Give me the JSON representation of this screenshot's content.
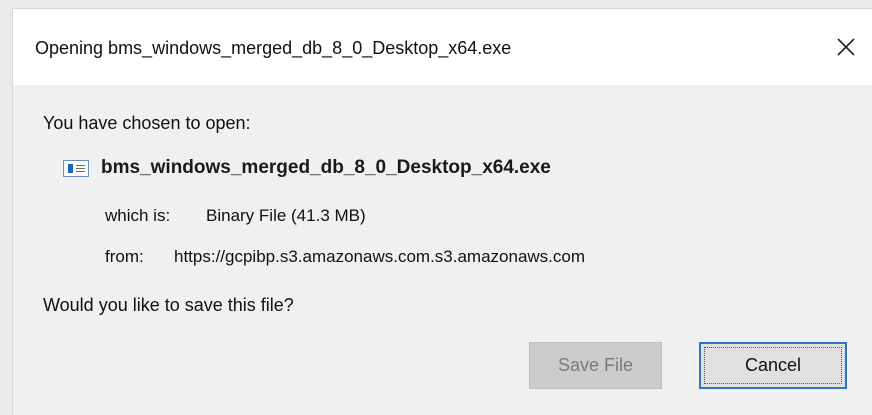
{
  "window": {
    "title": "Opening bms_windows_merged_db_8_0_Desktop_x64.exe",
    "close_icon": "close-icon"
  },
  "content": {
    "intro": "You have chosen to open:",
    "file_icon": "executable-file-icon",
    "filename": "bms_windows_merged_db_8_0_Desktop_x64.exe",
    "which_is_label": "which is:",
    "which_is_value": "Binary File (41.3 MB)",
    "from_label": "from:",
    "from_value": "https://gcpibp.s3.amazonaws.com.s3.amazonaws.com",
    "question": "Would you like to save this file?"
  },
  "buttons": {
    "save_label": "Save File",
    "save_state": "disabled",
    "cancel_label": "Cancel",
    "cancel_state": "focused"
  },
  "colors": {
    "accent": "#2f72c9",
    "background": "#f0f0f0",
    "titlebar": "#ffffff"
  }
}
